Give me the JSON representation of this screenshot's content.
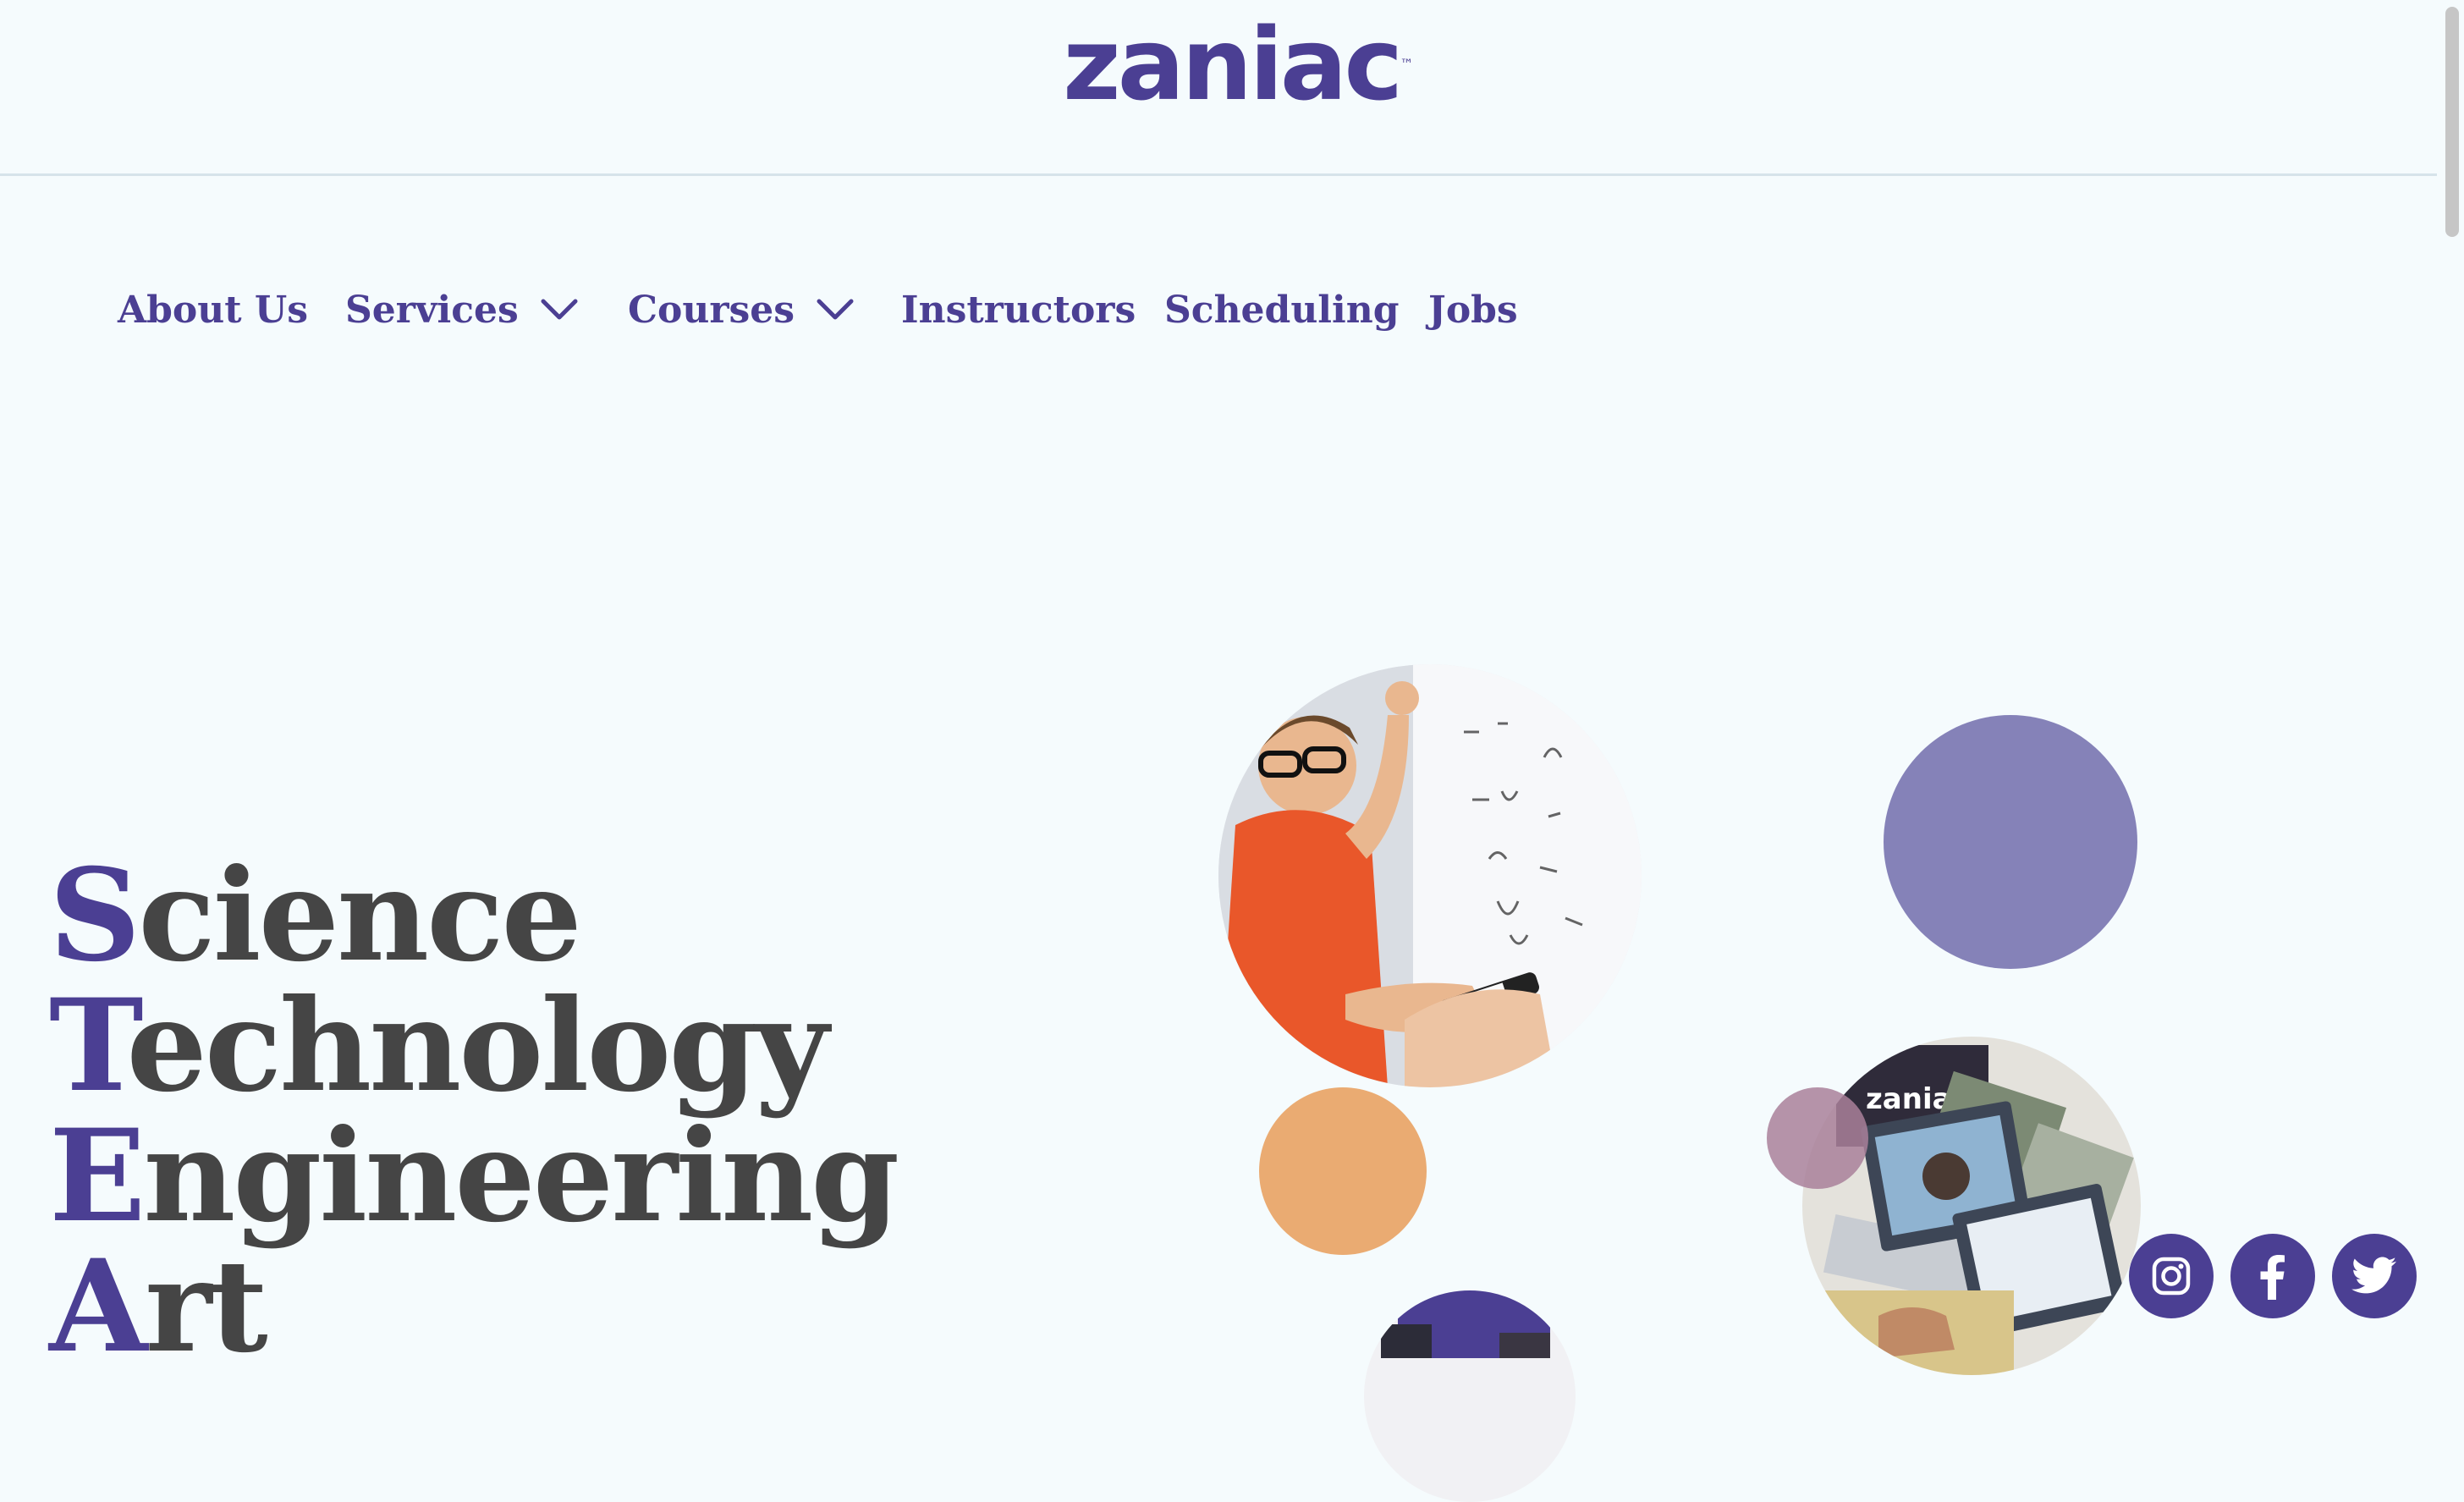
{
  "brand": {
    "logo_text": "zaniac",
    "trademark": "™"
  },
  "nav": {
    "items": [
      {
        "label": "About Us",
        "has_dropdown": false
      },
      {
        "label": "Services",
        "has_dropdown": true
      },
      {
        "label": "Courses",
        "has_dropdown": true
      },
      {
        "label": "Instructors",
        "has_dropdown": false
      },
      {
        "label": "Scheduling",
        "has_dropdown": false
      },
      {
        "label": "Jobs",
        "has_dropdown": false
      }
    ]
  },
  "hero": {
    "lines": [
      {
        "initial": "S",
        "rest": "cience"
      },
      {
        "initial": "T",
        "rest": "echnology"
      },
      {
        "initial": "E",
        "rest": "ngineering"
      },
      {
        "initial": "A",
        "rest": "rt"
      }
    ],
    "photo_badge_text": "zaniac"
  },
  "social": {
    "icons": [
      "instagram-icon",
      "facebook-icon",
      "twitter-icon"
    ]
  },
  "colors": {
    "brand_purple": "#4b3f93",
    "heading_gray": "#454545",
    "lavender": "#8582b8",
    "orange": "#eaab72",
    "background": "#f5fbfd"
  }
}
